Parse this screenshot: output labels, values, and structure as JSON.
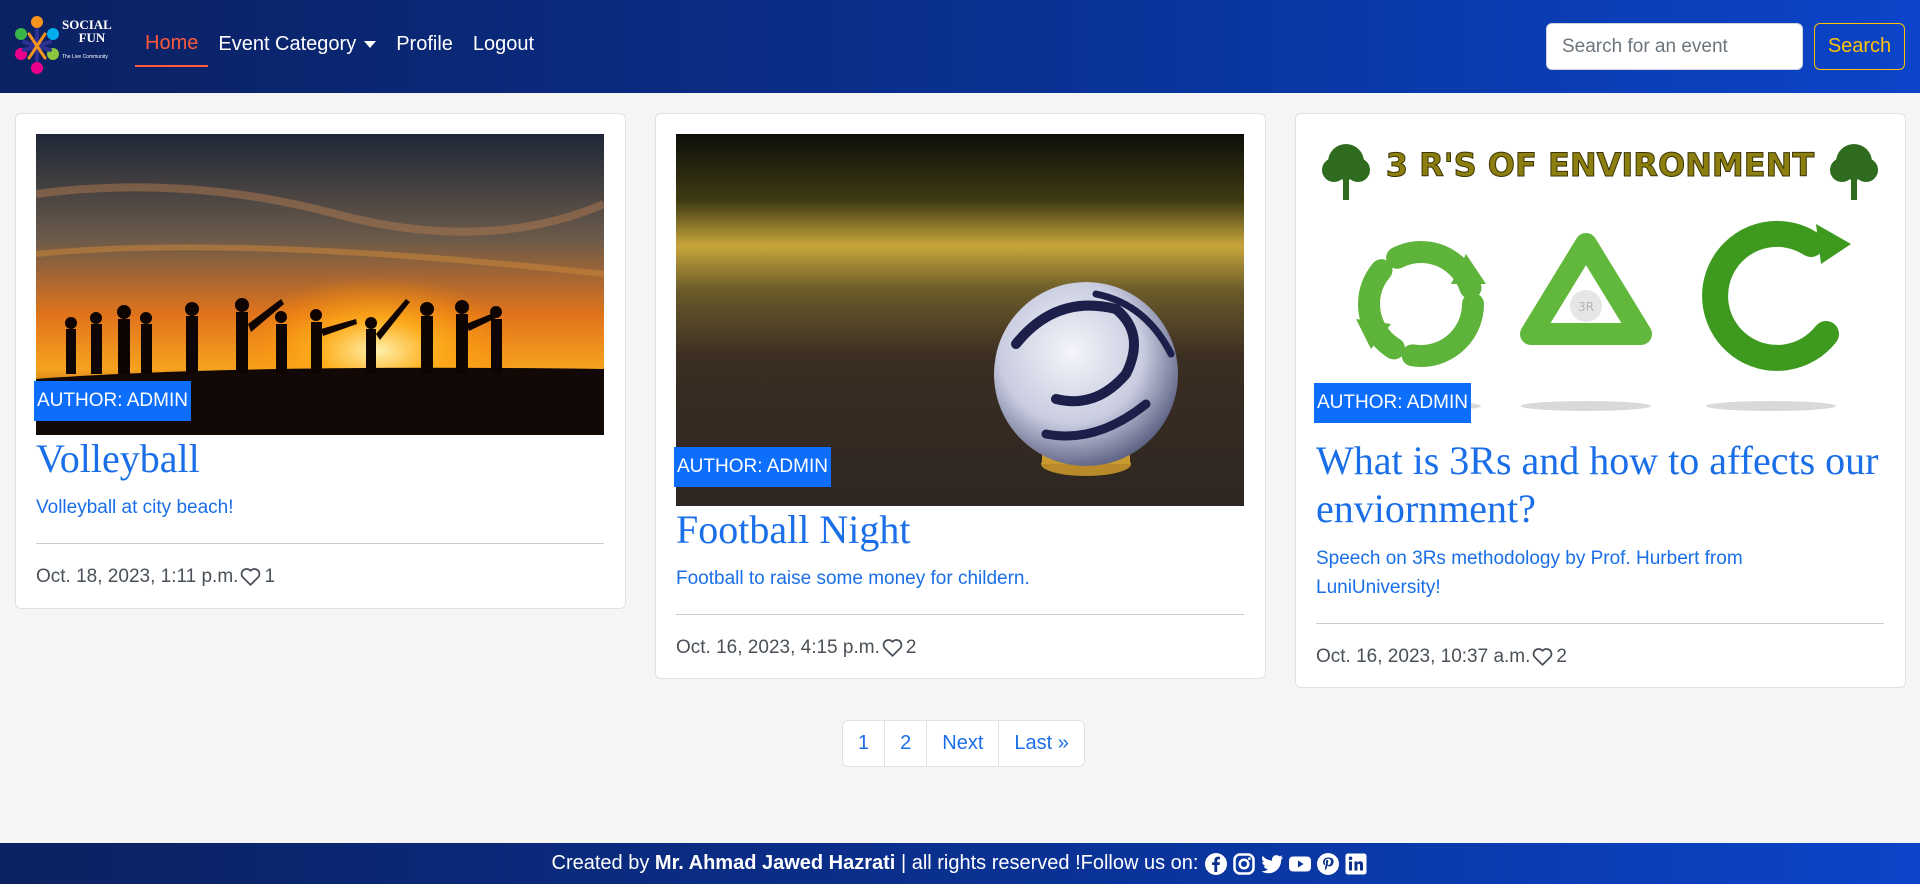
{
  "brand": {
    "name_line1": "SOCIAL",
    "name_line2": "FUN",
    "tagline": "The Live Community"
  },
  "nav": {
    "items": [
      {
        "label": "Home",
        "active": true
      },
      {
        "label": "Event Category",
        "dropdown": true
      },
      {
        "label": "Profile"
      },
      {
        "label": "Logout"
      }
    ],
    "search_placeholder": "Search for an event",
    "search_button": "Search"
  },
  "cards": [
    {
      "author": "AUTHOR: ADMIN",
      "title": "Volleyball",
      "description": "Volleyball at city beach!",
      "date": "Oct. 18, 2023, 1:11 p.m.",
      "likes": "1",
      "image": "sunset-silhouettes"
    },
    {
      "author": "AUTHOR: ADMIN",
      "title": "Football Night",
      "description": "Football to raise some money for childern.",
      "date": "Oct. 16, 2023, 4:15 p.m.",
      "likes": "2",
      "image": "football-ball"
    },
    {
      "author": "AUTHOR: ADMIN",
      "title": "What is 3Rs and how to affects our enviornment?",
      "description": "Speech on 3Rs methodology by Prof. Hurbert from LuniUniversity!",
      "date": "Oct. 16, 2023, 10:37 a.m.",
      "likes": "2",
      "image": "recycle-arrows",
      "image_heading": "3 R'S OF ENVIRONMENT",
      "image_badge": "3R"
    }
  ],
  "pagination": {
    "items": [
      "1",
      "2",
      "Next",
      "Last »"
    ]
  },
  "footer": {
    "created_by": "Created by",
    "author": "Mr. Ahmad Jawed Hazrati",
    "rights": "| all rights reserved !Follow us on:",
    "social": [
      "facebook-icon",
      "instagram-icon",
      "twitter-icon",
      "youtube-icon",
      "pinterest-icon",
      "linkedin-icon"
    ]
  },
  "colors": {
    "navbar_start": "#0b2161",
    "navbar_end": "#0b44c9",
    "active_link": "#ff5a3c",
    "link_blue": "#1a6fe8",
    "badge_blue": "#0d6efd",
    "search_outline": "#ffc107"
  }
}
